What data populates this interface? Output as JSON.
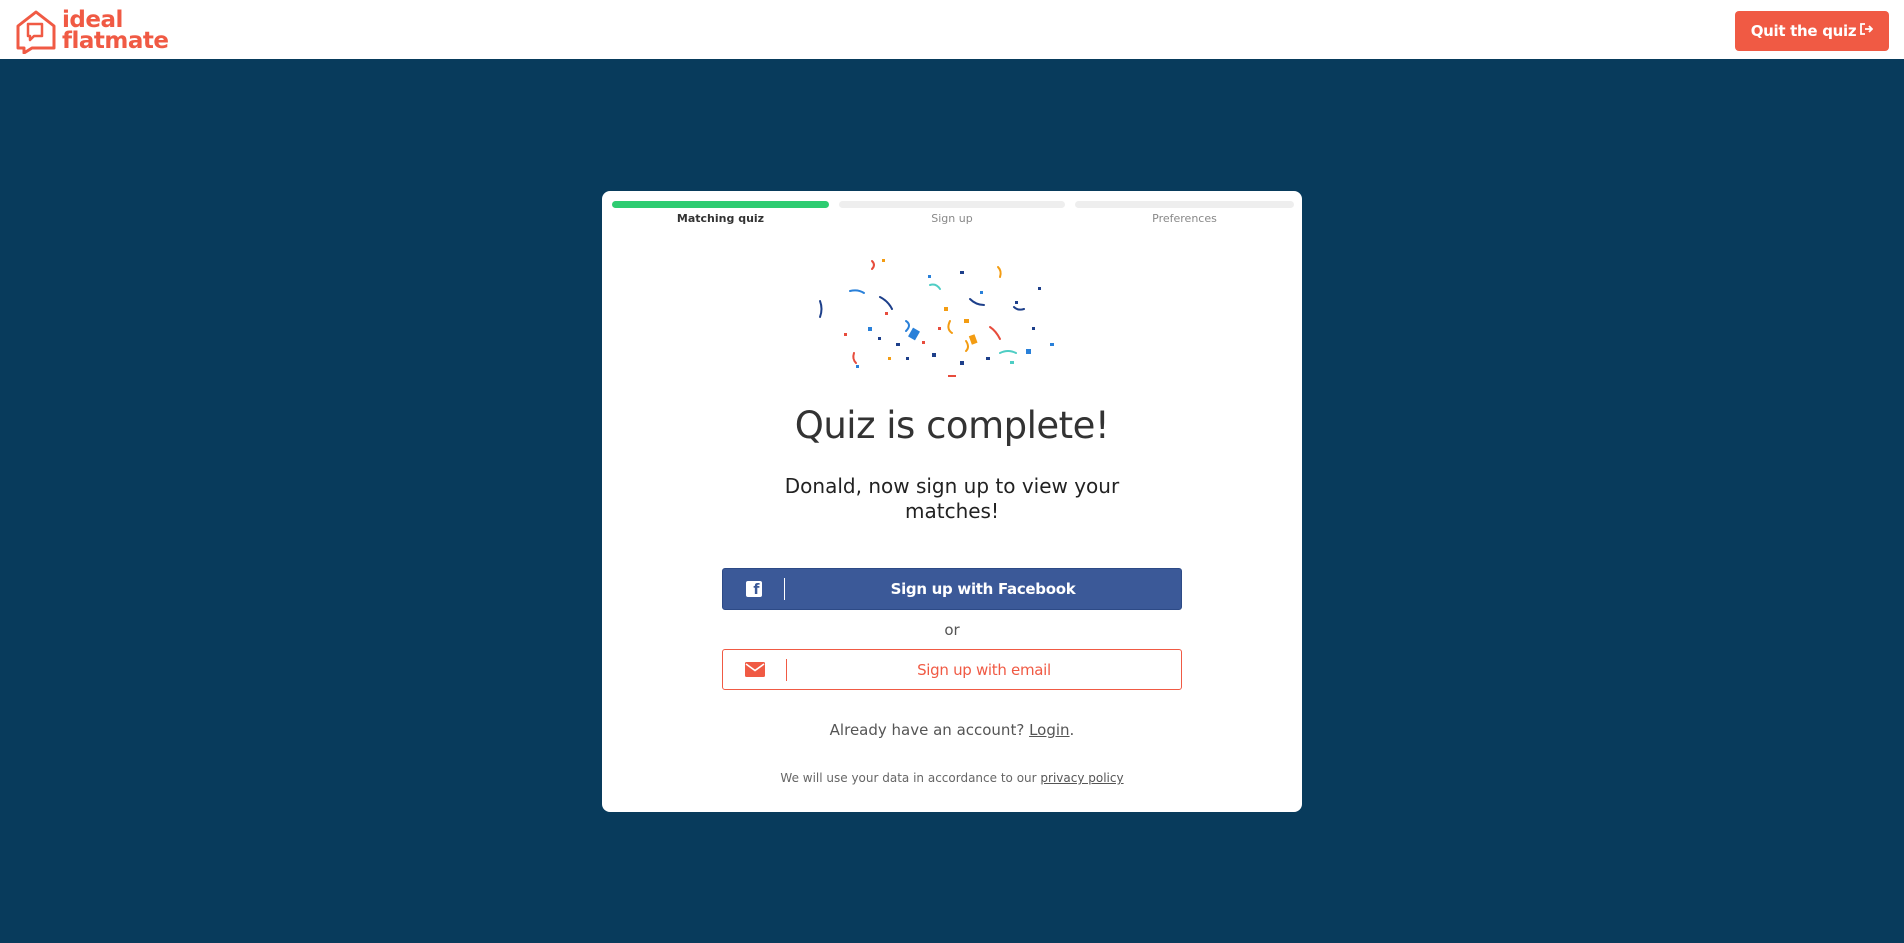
{
  "header": {
    "logo_line1": "ideal",
    "logo_line2": "flatmate",
    "quit_label": "Quit the quiz",
    "quit_icon": "sign-out-icon"
  },
  "steps": [
    {
      "label": "Matching quiz",
      "state": "complete"
    },
    {
      "label": "Sign up",
      "state": "pending"
    },
    {
      "label": "Preferences",
      "state": "pending"
    }
  ],
  "main": {
    "title": "Quiz is complete!",
    "subtitle": "Donald, now sign up to view your matches!",
    "facebook_label": "Sign up with Facebook",
    "facebook_icon": "facebook-icon",
    "or_text": "or",
    "email_label": "Sign up with email",
    "email_icon": "envelope-icon",
    "already_text": "Already have an account?",
    "login_link": "Login",
    "privacy_text": "We will use your data in accordance to our",
    "privacy_link": "privacy policy"
  },
  "colors": {
    "brand": "#f05a44",
    "background": "#083b5c",
    "facebook": "#3b5998",
    "progress": "#2ecc71"
  }
}
